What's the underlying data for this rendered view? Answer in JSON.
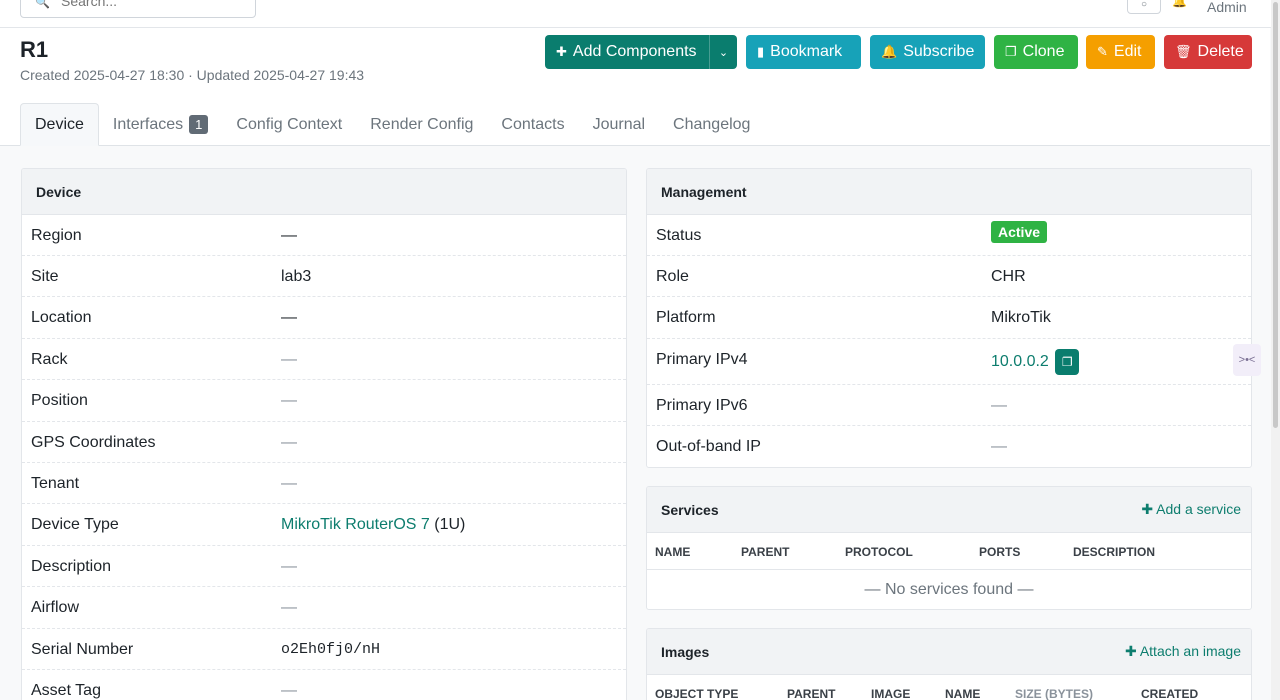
{
  "topbar": {
    "search_placeholder": "Search...",
    "user": "Admin"
  },
  "header": {
    "title": "R1",
    "meta": "Created 2025-04-27 18:30 · Updated 2025-04-27 19:43"
  },
  "actions": {
    "add_components": "Add Components",
    "bookmark": "Bookmark",
    "subscribe": "Subscribe",
    "clone": "Clone",
    "edit": "Edit",
    "delete": "Delete"
  },
  "tabs": [
    {
      "label": "Device",
      "active": true
    },
    {
      "label": "Interfaces",
      "badge": "1"
    },
    {
      "label": "Config Context"
    },
    {
      "label": "Render Config"
    },
    {
      "label": "Contacts"
    },
    {
      "label": "Journal"
    },
    {
      "label": "Changelog"
    }
  ],
  "device": {
    "title": "Device",
    "rows": [
      {
        "label": "Region",
        "value": "—"
      },
      {
        "label": "Site",
        "value": "lab3"
      },
      {
        "label": "Location",
        "value": "—"
      },
      {
        "label": "Rack",
        "value": "—"
      },
      {
        "label": "Position",
        "value": "—"
      },
      {
        "label": "GPS Coordinates",
        "value": "—"
      },
      {
        "label": "Tenant",
        "value": "—"
      },
      {
        "label": "Device Type",
        "value": "MikroTik RouterOS 7",
        "suffix": "(1U)"
      },
      {
        "label": "Description",
        "value": "—"
      },
      {
        "label": "Airflow",
        "value": "—"
      },
      {
        "label": "Serial Number",
        "value": "o2Eh0fj0/nH"
      },
      {
        "label": "Asset Tag",
        "value": "—"
      }
    ]
  },
  "management": {
    "title": "Management",
    "rows": [
      {
        "label": "Status",
        "value": "Active"
      },
      {
        "label": "Role",
        "value": "CHR"
      },
      {
        "label": "Platform",
        "value": "MikroTik"
      },
      {
        "label": "Primary IPv4",
        "value": "10.0.0.2"
      },
      {
        "label": "Primary IPv6",
        "value": "—"
      },
      {
        "label": "Out-of-band IP",
        "value": "—"
      }
    ]
  },
  "services": {
    "title": "Services",
    "action": "Add a service",
    "columns": [
      "NAME",
      "PARENT",
      "PROTOCOL",
      "PORTS",
      "DESCRIPTION"
    ],
    "empty": "— No services found —"
  },
  "images": {
    "title": "Images",
    "action": "Attach an image",
    "columns": [
      "OBJECT TYPE",
      "PARENT",
      "IMAGE",
      "NAME",
      "SIZE (BYTES)",
      "CREATED"
    ]
  },
  "colors": {
    "primary": "#0a7d6e",
    "info": "#17a2b8",
    "success": "#2fb344",
    "warning": "#f59f00",
    "danger": "#d63939"
  }
}
